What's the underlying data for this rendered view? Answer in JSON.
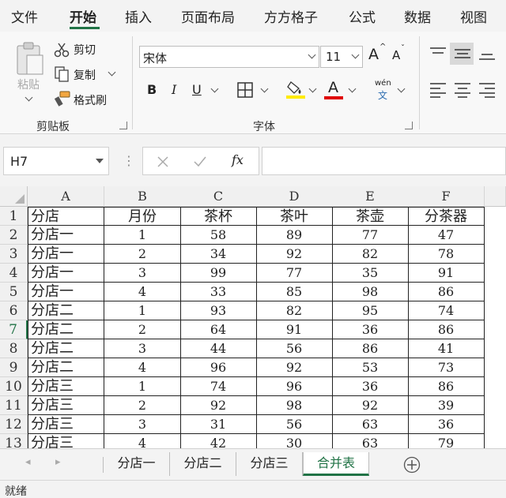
{
  "menu": {
    "tabs": [
      "文件",
      "开始",
      "插入",
      "页面布局",
      "方方格子",
      "公式",
      "数据",
      "视图"
    ]
  },
  "ribbon": {
    "clipboard": {
      "paste_label": "粘贴",
      "cut_label": "剪切",
      "copy_label": "复制",
      "format_painter_label": "格式刷",
      "group_label": "剪贴板"
    },
    "font": {
      "font_name": "宋体",
      "font_size": "11",
      "bold_label": "B",
      "italic_label": "I",
      "underline_label": "U",
      "font_color_label": "A",
      "phonetic_label": "wén",
      "phonetic_char": "文",
      "increase_label": "A",
      "decrease_label": "A",
      "group_label": "字体"
    }
  },
  "formula_bar": {
    "name_box": "H7",
    "fx_label": "fx",
    "formula": ""
  },
  "sheet": {
    "columns": [
      "A",
      "B",
      "C",
      "D",
      "E",
      "F"
    ],
    "rows": [
      {
        "num": "1",
        "cells": [
          "分店",
          "月份",
          "茶杯",
          "茶叶",
          "茶壶",
          "分茶器"
        ]
      },
      {
        "num": "2",
        "cells": [
          "分店一",
          "1",
          "58",
          "89",
          "77",
          "47"
        ]
      },
      {
        "num": "3",
        "cells": [
          "分店一",
          "2",
          "34",
          "92",
          "82",
          "78"
        ]
      },
      {
        "num": "4",
        "cells": [
          "分店一",
          "3",
          "99",
          "77",
          "35",
          "91"
        ]
      },
      {
        "num": "5",
        "cells": [
          "分店一",
          "4",
          "33",
          "85",
          "98",
          "86"
        ]
      },
      {
        "num": "6",
        "cells": [
          "分店二",
          "1",
          "93",
          "82",
          "95",
          "74"
        ]
      },
      {
        "num": "7",
        "cells": [
          "分店二",
          "2",
          "64",
          "91",
          "36",
          "86"
        ]
      },
      {
        "num": "8",
        "cells": [
          "分店二",
          "3",
          "44",
          "56",
          "86",
          "41"
        ]
      },
      {
        "num": "9",
        "cells": [
          "分店二",
          "4",
          "96",
          "92",
          "53",
          "73"
        ]
      },
      {
        "num": "10",
        "cells": [
          "分店三",
          "1",
          "74",
          "96",
          "36",
          "86"
        ]
      },
      {
        "num": "11",
        "cells": [
          "分店三",
          "2",
          "92",
          "98",
          "92",
          "39"
        ]
      },
      {
        "num": "12",
        "cells": [
          "分店三",
          "3",
          "31",
          "56",
          "63",
          "36"
        ]
      },
      {
        "num": "13",
        "cells": [
          "分店三",
          "4",
          "42",
          "30",
          "63",
          "79"
        ]
      }
    ]
  },
  "sheet_tabs": {
    "tabs": [
      "分店一",
      "分店二",
      "分店三",
      "合并表"
    ],
    "active": "合并表"
  },
  "status": {
    "text": "就绪"
  },
  "colors": {
    "accent": "#217346",
    "highlight_yellow": "#ffeb00",
    "font_red": "#e00000"
  }
}
